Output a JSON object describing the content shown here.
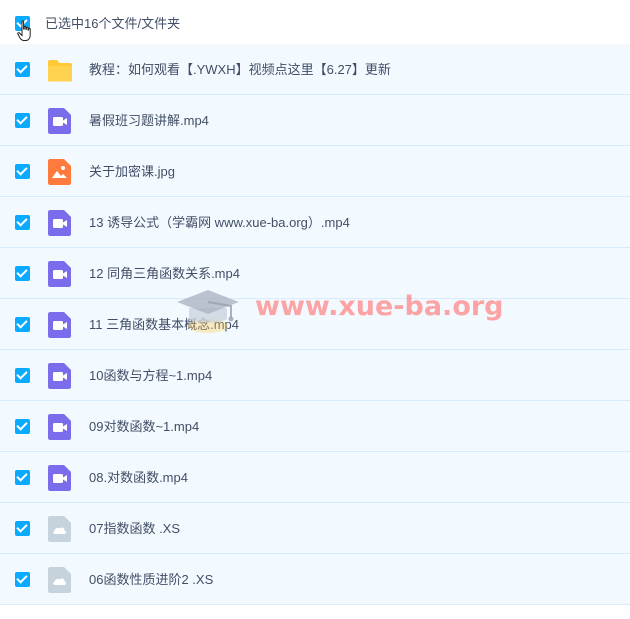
{
  "header": {
    "selected_text": "已选中16个文件/文件夹"
  },
  "watermark": {
    "text": "www.xue-ba.org"
  },
  "files": [
    {
      "name": "教程：如何观看【.YWXH】视频点这里【6.27】更新",
      "type": "folder",
      "icon": "folder-icon"
    },
    {
      "name": "暑假班习题讲解.mp4",
      "type": "video",
      "icon": "video-file-icon"
    },
    {
      "name": "关于加密课.jpg",
      "type": "image",
      "icon": "image-file-icon"
    },
    {
      "name": "13 诱导公式（学霸网 www.xue-ba.org）.mp4",
      "type": "video",
      "icon": "video-file-icon"
    },
    {
      "name": "12 同角三角函数关系.mp4",
      "type": "video",
      "icon": "video-file-icon"
    },
    {
      "name": "11 三角函数基本概念.mp4",
      "type": "video",
      "icon": "video-file-icon"
    },
    {
      "name": "10函数与方程~1.mp4",
      "type": "video",
      "icon": "video-file-icon"
    },
    {
      "name": "09对数函数~1.mp4",
      "type": "video",
      "icon": "video-file-icon"
    },
    {
      "name": "08.对数函数.mp4",
      "type": "video",
      "icon": "video-file-icon"
    },
    {
      "name": "07指数函数 .XS",
      "type": "unknown",
      "icon": "cloud-file-icon"
    },
    {
      "name": "06函数性质进阶2 .XS",
      "type": "unknown",
      "icon": "cloud-file-icon"
    }
  ],
  "colors": {
    "checkbox": "#09AAFF",
    "folder": "#FFC93A",
    "video": "#7A6CEB",
    "image": "#FF7A3D",
    "unknown": "#C6D2DC"
  }
}
